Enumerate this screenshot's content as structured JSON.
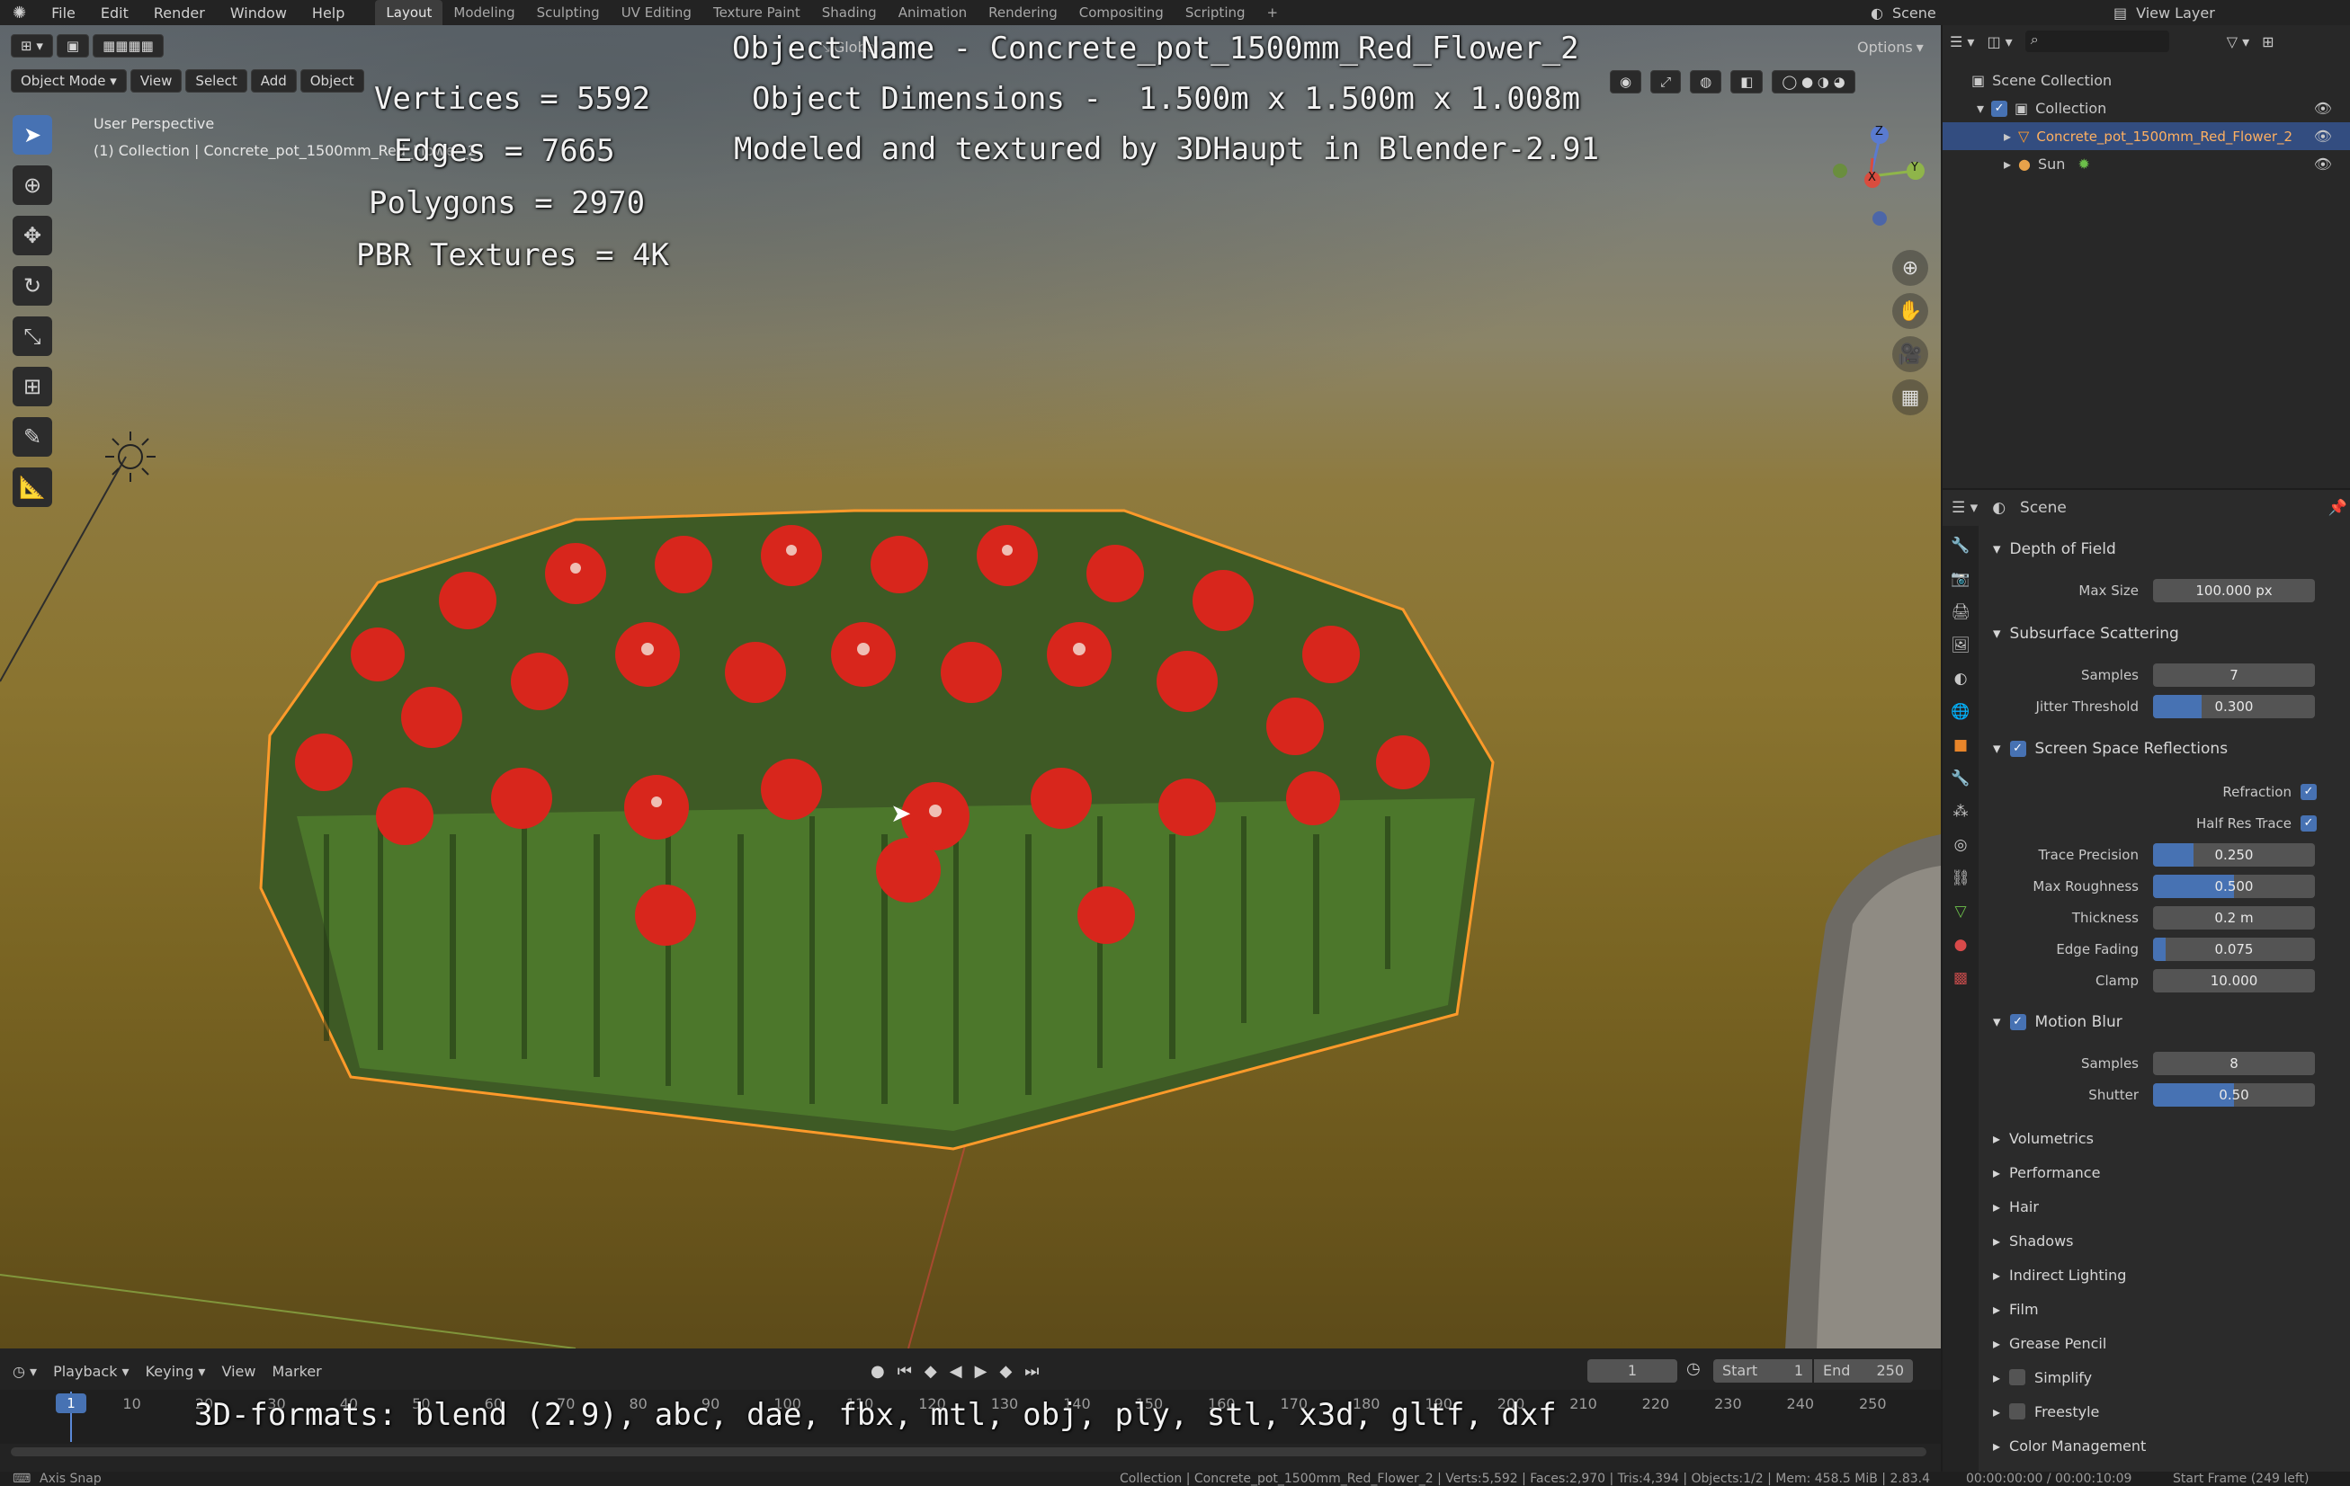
{
  "menus": [
    "File",
    "Edit",
    "Render",
    "Window",
    "Help"
  ],
  "workspaces": [
    "Layout",
    "Modeling",
    "Sculpting",
    "UV Editing",
    "Texture Paint",
    "Shading",
    "Animation",
    "Rendering",
    "Compositing",
    "Scripting"
  ],
  "active_workspace": "Layout",
  "topright": {
    "scene": "Scene",
    "view_layer": "View Layer"
  },
  "viewport": {
    "mode": "Object Mode",
    "menus": [
      "View",
      "Select",
      "Add",
      "Object"
    ],
    "transform": "Global",
    "options": "Options",
    "perspective": "User Perspective",
    "collection_info": "(1) Collection | Concrete_pot_1500mm_Red_Flower_2",
    "gizmo_axes": [
      "Z",
      "Y",
      "X"
    ]
  },
  "overlay": {
    "object_name": "Object Name - Concrete_pot_1500mm_Red_Flower_2",
    "dimensions": "Object Dimensions -  1.500m x 1.500m x 1.008m",
    "credit": "Modeled and textured by 3DHaupt in Blender-2.91",
    "vertices": "Vertices = 5592",
    "edges": "Edges = 7665",
    "polygons": "Polygons = 2970",
    "textures": "PBR Textures = 4K",
    "formats": "3D-formats: blend (2.9), abc, dae, fbx, mtl, obj, ply, stl, x3d, gltf, dxf"
  },
  "outliner": {
    "search": "",
    "items": [
      {
        "label": "Scene Collection"
      },
      {
        "label": "Collection"
      },
      {
        "label": "Concrete_pot_1500mm_Red_Flower_2"
      },
      {
        "label": "Sun"
      }
    ]
  },
  "properties": {
    "context": "Scene",
    "depth_of_field": {
      "title": "Depth of Field",
      "max_size_label": "Max Size",
      "max_size": "100.000 px"
    },
    "sss": {
      "title": "Subsurface Scattering",
      "samples_label": "Samples",
      "samples": "7",
      "jitter_label": "Jitter Threshold",
      "jitter": "0.300",
      "jitter_fill": 0.3
    },
    "ssr": {
      "title": "Screen Space Reflections",
      "enabled": true,
      "refraction_label": "Refraction",
      "half_res_label": "Half Res Trace",
      "trace_precision_label": "Trace Precision",
      "trace_precision": "0.250",
      "trace_precision_fill": 0.25,
      "max_roughness_label": "Max Roughness",
      "max_roughness": "0.500",
      "max_roughness_fill": 0.5,
      "thickness_label": "Thickness",
      "thickness": "0.2 m",
      "edge_fading_label": "Edge Fading",
      "edge_fading": "0.075",
      "edge_fading_fill": 0.075,
      "clamp_label": "Clamp",
      "clamp": "10.000"
    },
    "motion_blur": {
      "title": "Motion Blur",
      "enabled": true,
      "samples_label": "Samples",
      "samples": "8",
      "shutter_label": "Shutter",
      "shutter": "0.50",
      "shutter_fill": 0.5
    },
    "collapsed": [
      "Volumetrics",
      "Performance",
      "Hair",
      "Shadows",
      "Indirect Lighting",
      "Film",
      "Grease Pencil",
      "Simplify",
      "Freestyle",
      "Color Management"
    ]
  },
  "timeline": {
    "menus": [
      "Playback",
      "Keying",
      "View",
      "Marker"
    ],
    "current_frame": "1",
    "start_label": "Start",
    "start": "1",
    "end_label": "End",
    "end": "250",
    "ticks": [
      "1",
      "10",
      "20",
      "30",
      "40",
      "50",
      "60",
      "70",
      "80",
      "90",
      "100",
      "110",
      "120",
      "130",
      "140",
      "150",
      "160",
      "170",
      "180",
      "190",
      "200",
      "210",
      "220",
      "230",
      "240",
      "250"
    ]
  },
  "status": {
    "left": "Axis Snap",
    "center": "Collection | Concrete_pot_1500mm_Red_Flower_2 | Verts:5,592 | Faces:2,970 | Tris:4,394 | Objects:1/2 | Mem: 458.5 MiB | 2.83.4",
    "time": "00:00:00:00 / 00:00:10:09",
    "frame": "Start Frame (249 left)"
  }
}
